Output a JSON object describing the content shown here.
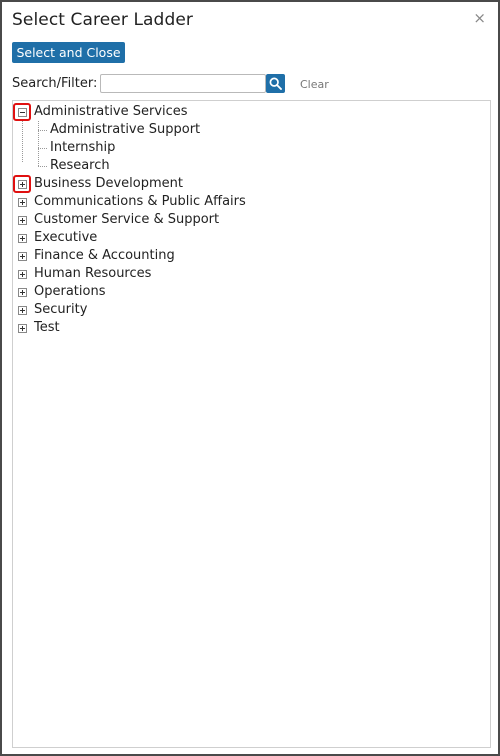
{
  "dialog": {
    "title": "Select Career Ladder",
    "close_glyph": "×"
  },
  "toolbar": {
    "select_close_label": "Select and Close"
  },
  "filter": {
    "label": "Search/Filter:",
    "value": "",
    "placeholder": "",
    "search_icon": "search-icon",
    "clear_label": "Clear"
  },
  "tree": {
    "items": [
      {
        "label": "Administrative Services",
        "expanded": true,
        "highlighted": true,
        "children": [
          {
            "label": "Administrative Support"
          },
          {
            "label": "Internship"
          },
          {
            "label": "Research"
          }
        ]
      },
      {
        "label": "Business Development",
        "expanded": false,
        "highlighted": true
      },
      {
        "label": "Communications & Public Affairs",
        "expanded": false
      },
      {
        "label": "Customer Service & Support",
        "expanded": false
      },
      {
        "label": "Executive",
        "expanded": false
      },
      {
        "label": "Finance & Accounting",
        "expanded": false
      },
      {
        "label": "Human Resources",
        "expanded": false
      },
      {
        "label": "Operations",
        "expanded": false
      },
      {
        "label": "Security",
        "expanded": false
      },
      {
        "label": "Test",
        "expanded": false
      }
    ]
  },
  "colors": {
    "accent": "#1f6fa8",
    "highlight": "#e01010"
  }
}
